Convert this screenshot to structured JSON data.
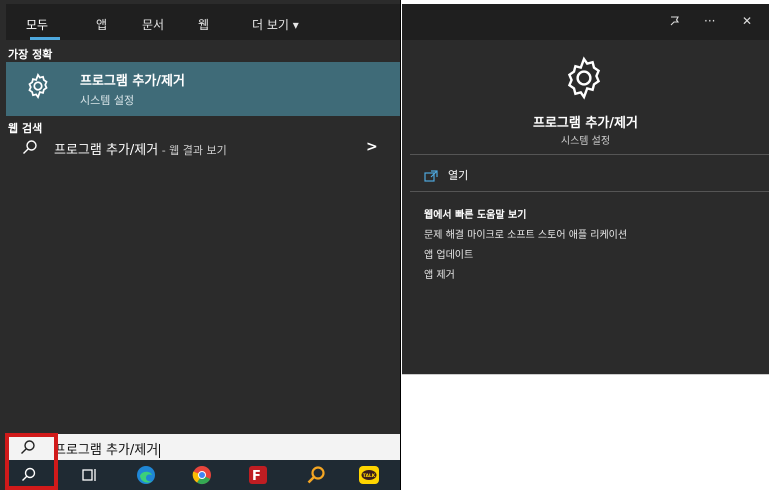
{
  "tabs": [
    {
      "label": "모두"
    },
    {
      "label": "앱"
    },
    {
      "label": "문서"
    },
    {
      "label": "웹"
    },
    {
      "label": "더 보기 ▾"
    }
  ],
  "best_match": {
    "section_label": "가장 정확",
    "title": "프로그램 추가/제거",
    "subtitle": "시스템 설정",
    "icon": "gear-icon"
  },
  "web_search": {
    "section_label": "웹 검색",
    "query": "프로그램 추가/제거",
    "suffix": " - 웹 결과 보기",
    "arrow": ">"
  },
  "search_box": {
    "value": "프로그램 추가/제거"
  },
  "taskbar": {
    "icons": [
      "search-icon",
      "task-view-icon",
      "edge-icon",
      "chrome-icon",
      "filezilla-icon",
      "search-app-icon",
      "kakaotalk-icon"
    ],
    "kakaotalk_label": "TALK"
  },
  "details": {
    "title": "프로그램 추가/제거",
    "subtitle": "시스템 설정",
    "open_label": "열기",
    "web_heading": "웹에서 빠른 도움말 보기",
    "links": [
      "문제 해결 마이크로 소프트 스토어 애플 리케이션",
      "앱 업데이트",
      "앱 제거"
    ],
    "controls": {
      "more": "···",
      "close": "✕"
    }
  },
  "colors": {
    "panel_bg": "#2b2b2b",
    "tabs_bg": "#1f1f1f",
    "best_match_bg": "#3f6b78",
    "accent": "#4ea8de",
    "highlight": "#d11a1a"
  }
}
